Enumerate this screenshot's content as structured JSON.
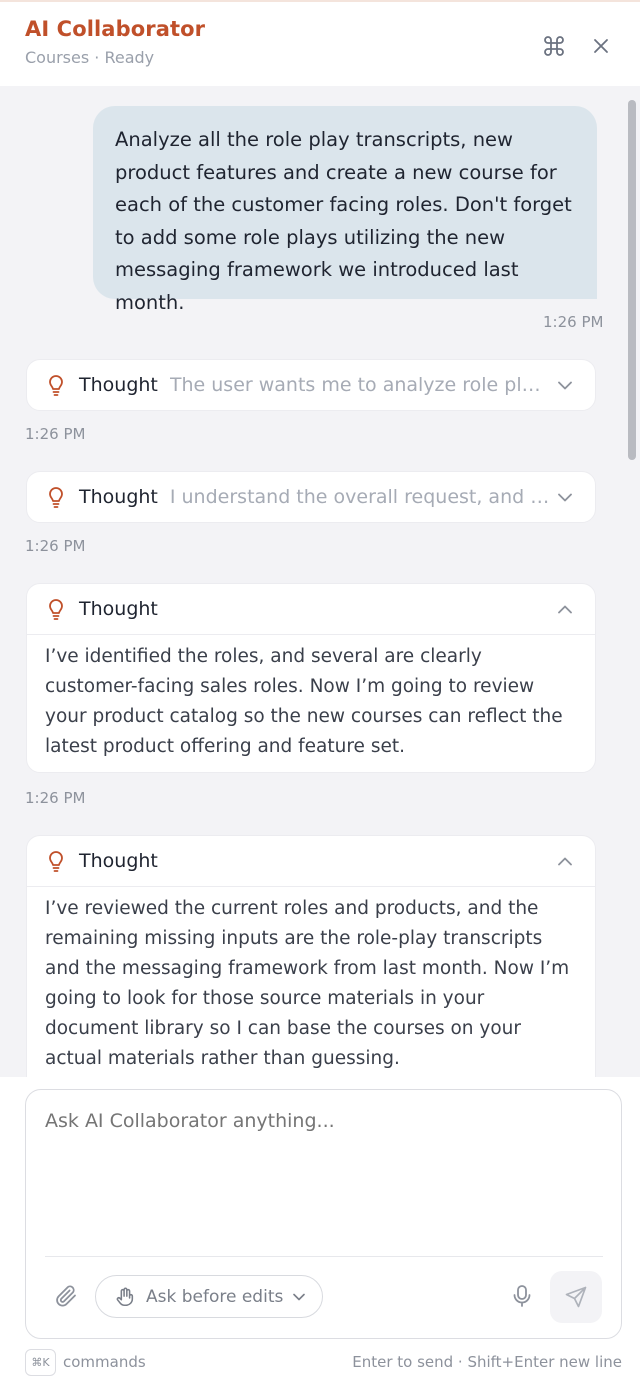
{
  "header": {
    "title": "AI Collaborator",
    "subtitle": "Courses · Ready",
    "command_icon": "command-icon",
    "close_icon": "close-icon"
  },
  "colors": {
    "accent": "#c0502a",
    "user_bubble": "#dbe5ec",
    "chat_bg": "#f3f3f6"
  },
  "messages": {
    "user": {
      "text": "Analyze all the role play transcripts, new product features and create a new course for each of the customer facing roles. Don't forget to add some role plays utilizing the new messaging framework we introduced last month.",
      "time": "1:26 PM"
    },
    "thoughts": [
      {
        "label": "Thought",
        "preview": "The user wants me to analyze role play transcripts, new product features…",
        "expanded": false,
        "time": "1:26 PM"
      },
      {
        "label": "Thought",
        "preview": "I understand the overall request, and first let me look at the roles…",
        "expanded": false,
        "time": "1:26 PM"
      },
      {
        "label": "Thought",
        "body": "I’ve identified the roles, and several are clearly customer-facing sales roles. Now I’m going to review your product catalog so the new courses can reflect the latest product offering and feature set.",
        "expanded": true,
        "time": "1:26 PM"
      },
      {
        "label": "Thought",
        "body": "I’ve reviewed the current roles and products, and the remaining missing inputs are the role-play transcripts and the messaging framework from last month. Now I’m going to look for those source materials in your document library so I can base the courses on your actual materials rather than guessing.",
        "expanded": true
      }
    ]
  },
  "composer": {
    "placeholder": "Ask AI Collaborator anything...",
    "mode_label": "Ask before edits",
    "attach_icon": "paperclip-icon",
    "mode_icon": "hand-icon",
    "mic_icon": "microphone-icon",
    "send_icon": "send-icon"
  },
  "footer": {
    "shortcut": "⌘K",
    "commands_label": "commands",
    "hint": "Enter to send · Shift+Enter new line"
  }
}
